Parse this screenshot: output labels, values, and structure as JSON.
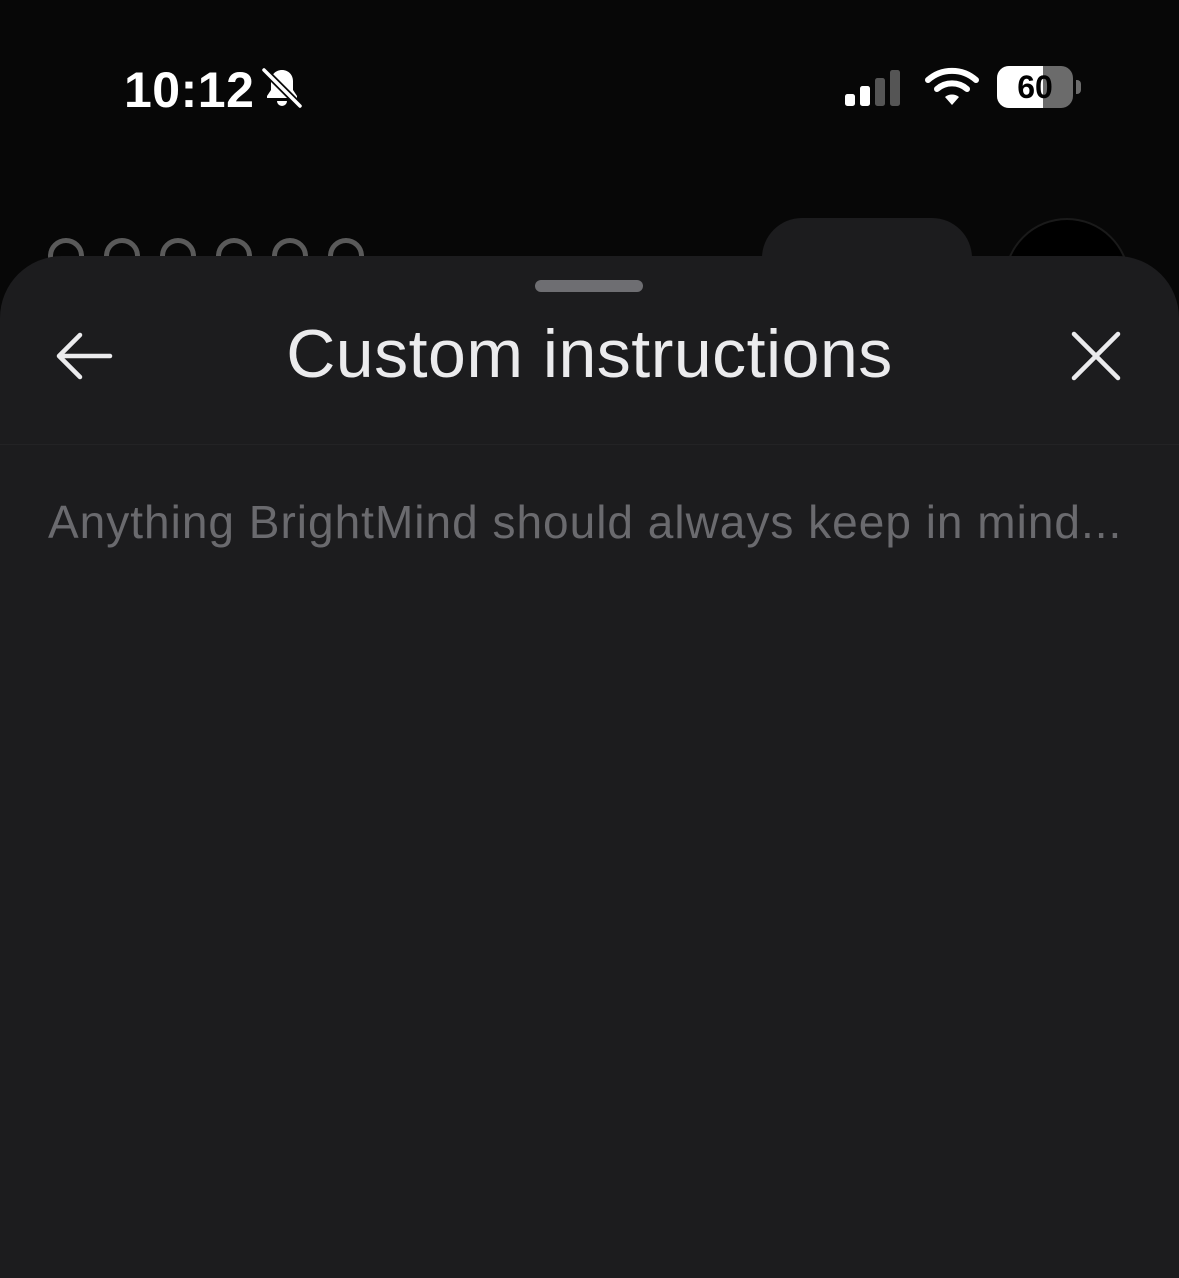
{
  "status_bar": {
    "time": "10:12",
    "silent_mode_icon": "bell-slash-icon",
    "signal_icon": "cellular-signal-icon",
    "signal_bars_active": 2,
    "signal_bars_total": 4,
    "wifi_icon": "wifi-icon",
    "battery_level": "60",
    "battery_fraction": 0.6
  },
  "sheet": {
    "title": "Custom instructions",
    "back_icon": "arrow-left-icon",
    "close_icon": "close-icon",
    "input": {
      "value": "",
      "placeholder": "Anything BrightMind should always keep in mind..."
    }
  },
  "colors": {
    "background": "#070707",
    "sheet": "#1c1c1e",
    "title_text": "#ebebed",
    "placeholder_text": "#6a6a6e",
    "grabber": "#6e6e72"
  }
}
